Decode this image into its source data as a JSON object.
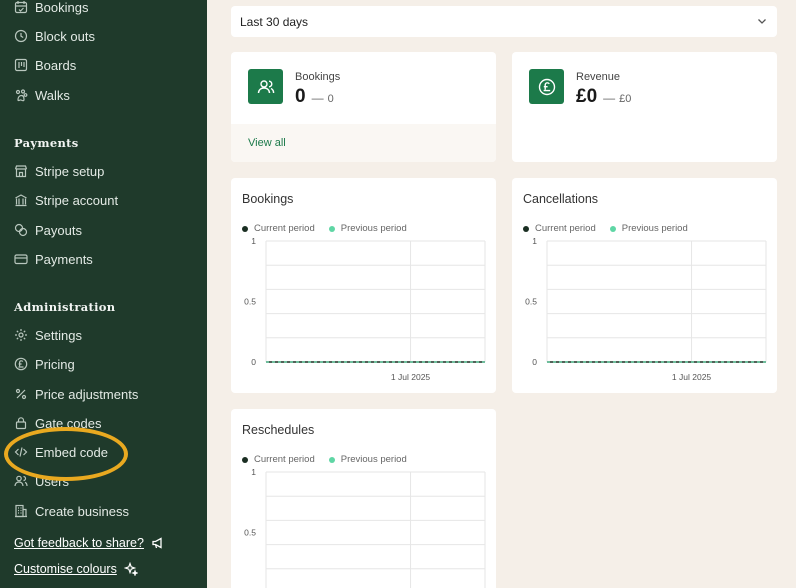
{
  "sidebar": {
    "top_items": [
      {
        "label": "Bookings",
        "icon": "calendar-check-icon"
      },
      {
        "label": "Block outs",
        "icon": "clock-icon"
      },
      {
        "label": "Boards",
        "icon": "board-icon"
      },
      {
        "label": "Walks",
        "icon": "paw-icon"
      }
    ],
    "payments_title": "Payments",
    "payments_items": [
      {
        "label": "Stripe setup",
        "icon": "store-icon"
      },
      {
        "label": "Stripe account",
        "icon": "bank-icon"
      },
      {
        "label": "Payouts",
        "icon": "coins-icon"
      },
      {
        "label": "Payments",
        "icon": "card-icon"
      }
    ],
    "admin_title": "Administration",
    "admin_items": [
      {
        "label": "Settings",
        "icon": "gear-icon"
      },
      {
        "label": "Pricing",
        "icon": "pound-icon"
      },
      {
        "label": "Price adjustments",
        "icon": "percent-icon"
      },
      {
        "label": "Gate codes",
        "icon": "lock-icon"
      },
      {
        "label": "Embed code",
        "icon": "code-icon"
      },
      {
        "label": "Users",
        "icon": "users-icon"
      },
      {
        "label": "Create business",
        "icon": "building-icon"
      }
    ],
    "feedback_label": "Got feedback to share?",
    "colours_label": "Customise colours",
    "highlight_color": "#e9a920"
  },
  "filter": {
    "selected": "Last 30 days"
  },
  "stats": {
    "bookings": {
      "label": "Bookings",
      "value": "0",
      "prev_value": "0",
      "link": "View all"
    },
    "revenue": {
      "label": "Revenue",
      "value": "£0",
      "prev_value": "£0"
    }
  },
  "legend": {
    "current": "Current period",
    "previous": "Previous period",
    "current_color": "#1a2e22",
    "previous_color": "#5fd6a5"
  },
  "chart_data": [
    {
      "type": "line",
      "title": "Bookings",
      "x": [
        "1 Jul 2025"
      ],
      "yticks": [
        "1",
        "0.5",
        "0"
      ],
      "ylim": [
        0,
        1
      ],
      "series": [
        {
          "name": "Current period",
          "values": [
            0
          ]
        },
        {
          "name": "Previous period",
          "values": [
            0
          ]
        }
      ],
      "grid": true
    },
    {
      "type": "line",
      "title": "Cancellations",
      "x": [
        "1 Jul 2025"
      ],
      "yticks": [
        "1",
        "0.5",
        "0"
      ],
      "ylim": [
        0,
        1
      ],
      "series": [
        {
          "name": "Current period",
          "values": [
            0
          ]
        },
        {
          "name": "Previous period",
          "values": [
            0
          ]
        }
      ],
      "grid": true
    },
    {
      "type": "line",
      "title": "Reschedules",
      "x": [],
      "yticks": [
        "1",
        "0.5"
      ],
      "ylim": [
        0,
        1
      ],
      "series": [
        {
          "name": "Current period",
          "values": []
        },
        {
          "name": "Previous period",
          "values": []
        }
      ],
      "grid": true
    }
  ]
}
